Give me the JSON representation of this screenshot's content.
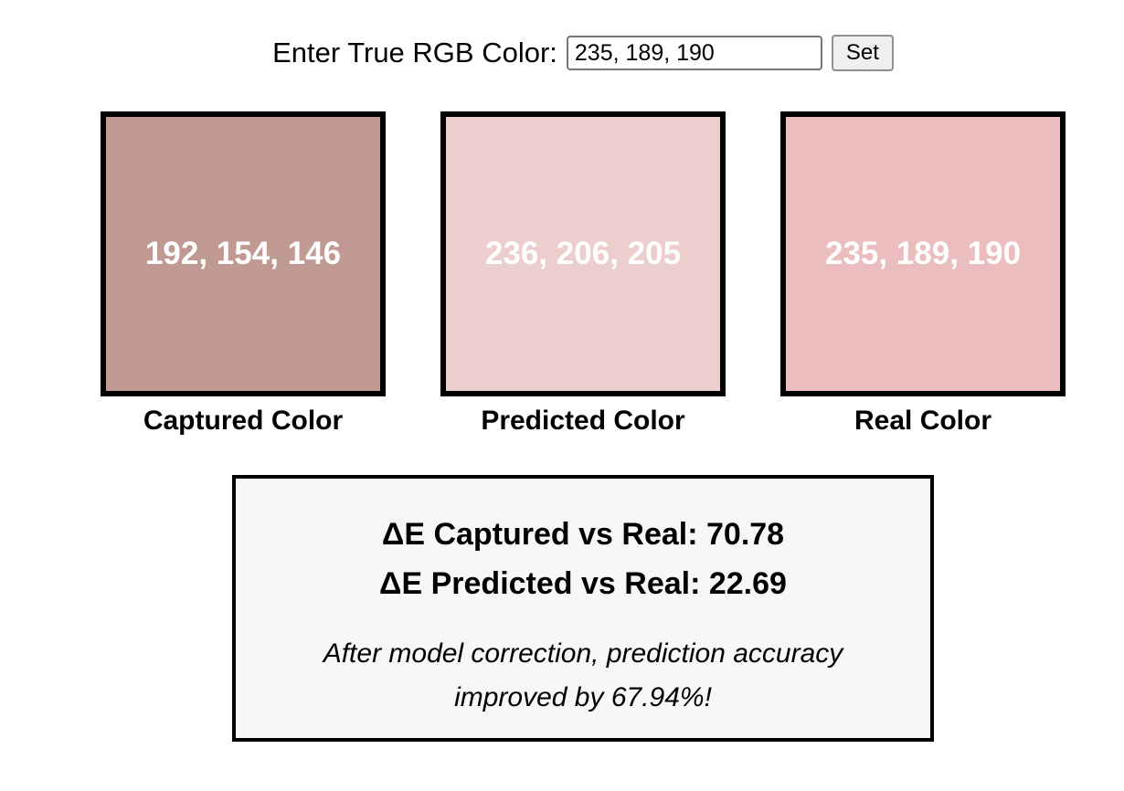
{
  "input_row": {
    "label": "Enter True RGB Color:",
    "value": "235, 189, 190",
    "button_label": "Set"
  },
  "swatches": [
    {
      "id": "captured",
      "value_text": "192, 154, 146",
      "color": "#c09a92",
      "label": "Captured Color"
    },
    {
      "id": "predicted",
      "value_text": "236, 206, 205",
      "color": "#eccecd",
      "label": "Predicted Color"
    },
    {
      "id": "real",
      "value_text": "235, 189, 190",
      "color": "#ebbdbe",
      "label": "Real Color"
    }
  ],
  "results": {
    "delta_captured": "ΔE Captured vs Real: 70.78",
    "delta_predicted": "ΔE Predicted vs Real: 22.69",
    "summary": "After model correction, prediction accuracy improved by 67.94%!"
  }
}
